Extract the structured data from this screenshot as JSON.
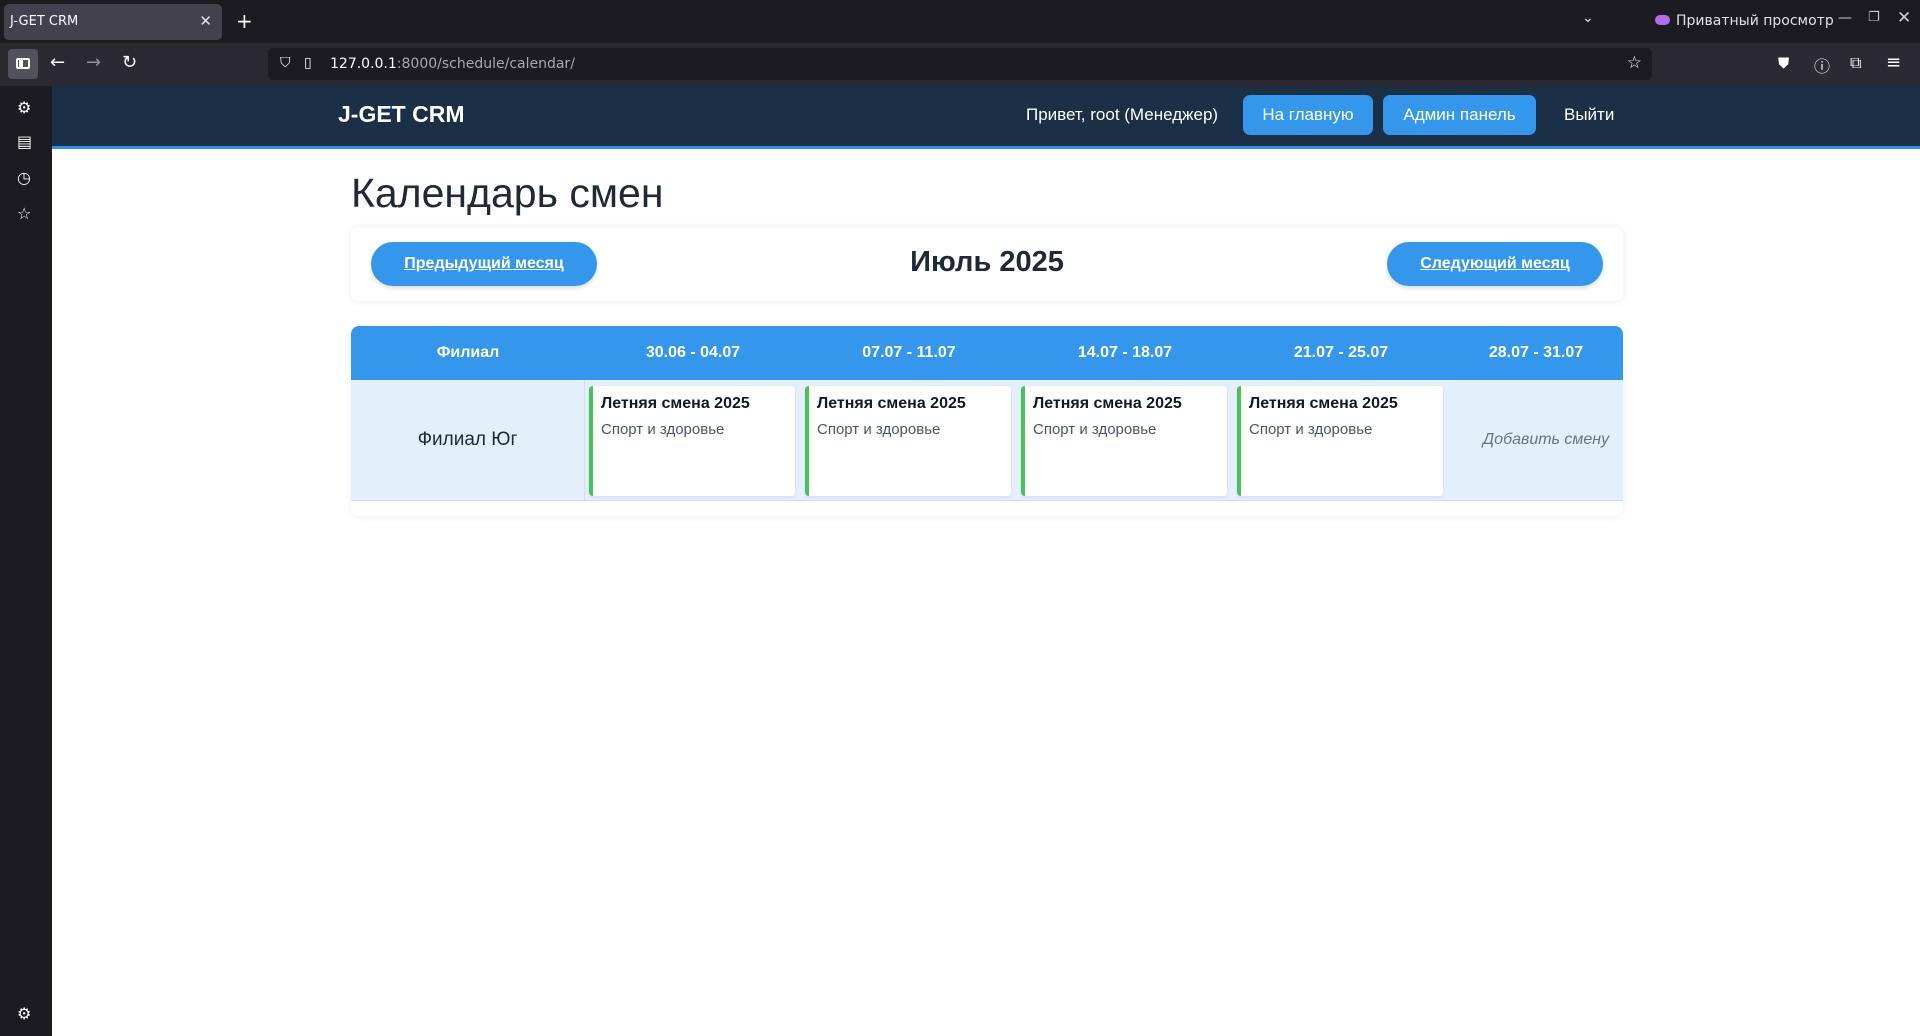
{
  "browser": {
    "tab_title": "J-GET CRM",
    "tab_close": "✕",
    "new_tab": "+",
    "private_label": "Приватный просмотр",
    "url_host": "127.0.0.1",
    "url_path": ":8000/schedule/calendar/"
  },
  "header": {
    "logo": "J-GET CRM",
    "greeting": "Привет, root (Менеджер)",
    "home_button": "На главную",
    "admin_button": "Админ панель",
    "logout_link": "Выйти"
  },
  "page": {
    "title": "Календарь смен"
  },
  "month_nav": {
    "prev_label": "Предыдущий месяц",
    "current": "Июль 2025",
    "next_label": "Следующий месяц"
  },
  "calendar": {
    "branch_header": "Филиал",
    "weeks": [
      "30.06 - 04.07",
      "07.07 - 11.07",
      "14.07 - 18.07",
      "21.07 - 25.07",
      "28.07 - 31.07"
    ],
    "rows": [
      {
        "branch": "Филиал Юг",
        "shifts": [
          {
            "title": "Летняя смена 2025",
            "subtitle": "Спорт и здоровье"
          },
          {
            "title": "Летняя смена 2025",
            "subtitle": "Спорт и здоровье"
          },
          {
            "title": "Летняя смена 2025",
            "subtitle": "Спорт и здоровье"
          },
          {
            "title": "Летняя смена 2025",
            "subtitle": "Спорт и здоровье"
          }
        ],
        "add_label": "Добавить смену"
      }
    ],
    "shift_accent_color": "#46c25a",
    "header_color": "#3597eb"
  }
}
